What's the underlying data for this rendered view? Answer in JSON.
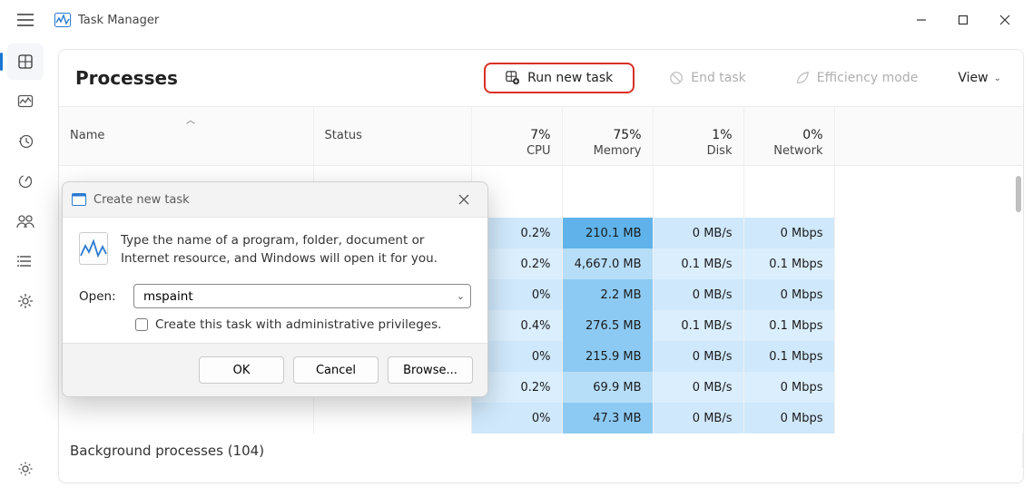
{
  "app": {
    "title": "Task Manager"
  },
  "page": {
    "title": "Processes"
  },
  "toolbar": {
    "run_new_task": "Run new task",
    "end_task": "End task",
    "efficiency_mode": "Efficiency mode",
    "view": "View"
  },
  "columns": {
    "name": "Name",
    "status": "Status",
    "cpu_pct": "7%",
    "cpu": "CPU",
    "mem_pct": "75%",
    "mem": "Memory",
    "disk_pct": "1%",
    "disk": "Disk",
    "net_pct": "0%",
    "net": "Network"
  },
  "rows": [
    {
      "cpu": "0.2%",
      "mem": "210.1 MB",
      "disk": "0 MB/s",
      "net": "0 Mbps"
    },
    {
      "cpu": "0.2%",
      "mem": "4,667.0 MB",
      "disk": "0.1 MB/s",
      "net": "0.1 Mbps"
    },
    {
      "cpu": "0%",
      "mem": "2.2 MB",
      "disk": "0 MB/s",
      "net": "0 Mbps"
    },
    {
      "cpu": "0.4%",
      "mem": "276.5 MB",
      "disk": "0.1 MB/s",
      "net": "0.1 Mbps"
    },
    {
      "cpu": "0%",
      "mem": "215.9 MB",
      "disk": "0 MB/s",
      "net": "0.1 Mbps"
    },
    {
      "cpu": "0.2%",
      "mem": "69.9 MB",
      "disk": "0 MB/s",
      "net": "0 Mbps"
    },
    {
      "cpu": "0%",
      "mem": "47.3 MB",
      "disk": "0 MB/s",
      "net": "0 Mbps"
    }
  ],
  "group": {
    "background": "Background processes (104)"
  },
  "dialog": {
    "title": "Create new task",
    "message": "Type the name of a program, folder, document or Internet resource, and Windows will open it for you.",
    "open_label": "Open:",
    "open_value": "mspaint",
    "admin_checkbox": "Create this task with administrative privileges.",
    "ok": "OK",
    "cancel": "Cancel",
    "browse": "Browse..."
  }
}
